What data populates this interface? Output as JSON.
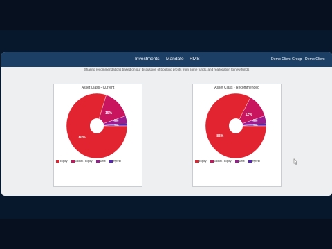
{
  "nav": {
    "items": [
      "Investments",
      "Mandate",
      "RMS"
    ],
    "client": "Demo Client Group - Demo Client"
  },
  "subtitle": "Sharing recommendations based on our discussion of booking profits from some funds, and reallocation to new funds",
  "chart_data": [
    {
      "type": "pie",
      "title": "Asset Class - Current",
      "categories": [
        "Equity",
        "Global - Equity",
        "Debt",
        "Hybrid"
      ],
      "values": [
        80,
        15,
        4,
        1
      ],
      "labels": [
        "80%",
        "15%",
        "4%",
        "1%"
      ],
      "colors": [
        "#e1242f",
        "#c8155d",
        "#9b1c8f",
        "#5b24b8"
      ],
      "donut": true,
      "legend_position": "bottom-left"
    },
    {
      "type": "pie",
      "title": "Asset Class - Recommended",
      "categories": [
        "Equity",
        "Global - Equity",
        "Debt",
        "Hybrid"
      ],
      "values": [
        83,
        12,
        4,
        1
      ],
      "labels": [
        "83%",
        "12%",
        "4%",
        "1%"
      ],
      "colors": [
        "#e1242f",
        "#c8155d",
        "#9b1c8f",
        "#5b24b8"
      ],
      "donut": true,
      "legend_position": "bottom-left"
    }
  ]
}
